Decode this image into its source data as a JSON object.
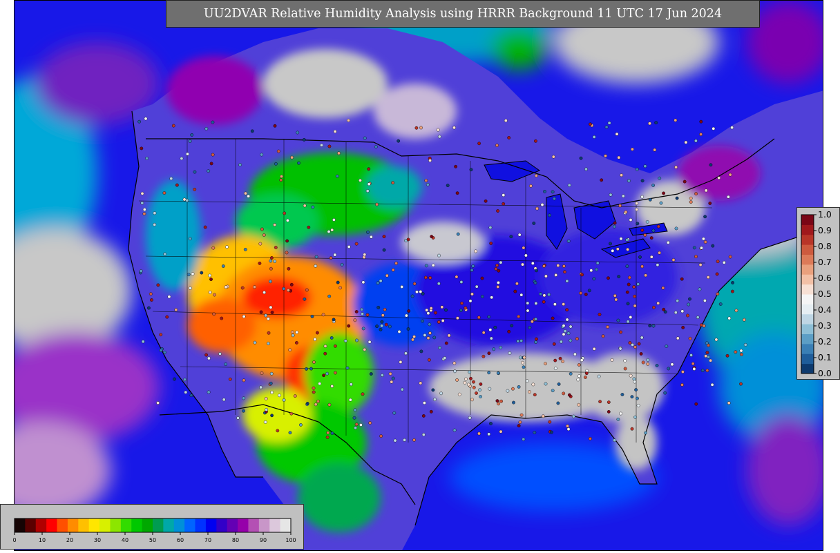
{
  "title": "UU2DVAR Relative Humidity Analysis using HRRR Background 11 UTC 17 Jun 2024",
  "rh_colorbar": {
    "min": 0,
    "max": 100,
    "ticks": [
      "0",
      "10",
      "20",
      "30",
      "40",
      "50",
      "60",
      "70",
      "80",
      "90",
      "100"
    ],
    "colors": [
      "#160404",
      "#5a0000",
      "#b00000",
      "#ff0000",
      "#ff5000",
      "#ff8c00",
      "#ffc000",
      "#ffe600",
      "#d8f000",
      "#8ce600",
      "#32dc00",
      "#00c800",
      "#00a800",
      "#009c50",
      "#00a8a8",
      "#0090d8",
      "#0064ff",
      "#0032ff",
      "#0000f0",
      "#3200c8",
      "#6400b4",
      "#9600aa",
      "#b450b4",
      "#c896c8",
      "#dcc8dc",
      "#e6e6e6"
    ]
  },
  "obs_colorbar": {
    "min": 0.0,
    "max": 1.0,
    "ticks": [
      "0.0",
      "0.1",
      "0.2",
      "0.3",
      "0.4",
      "0.5",
      "0.6",
      "0.7",
      "0.8",
      "0.9",
      "1.0"
    ],
    "colors": [
      "#0d3a6e",
      "#1f5d9a",
      "#3a7fb5",
      "#5c9ec5",
      "#8ebfd6",
      "#bfd6e4",
      "#e6eef2",
      "#f5f5f5",
      "#f7e0d4",
      "#f2c0a6",
      "#e9a07d",
      "#dc7a58",
      "#cd5a3e",
      "#b83528",
      "#a0181c",
      "#7a0616"
    ]
  },
  "map": {
    "ocean_color": "#1818e8",
    "land_color": "#c4c4c4",
    "border_color": "#000000"
  }
}
